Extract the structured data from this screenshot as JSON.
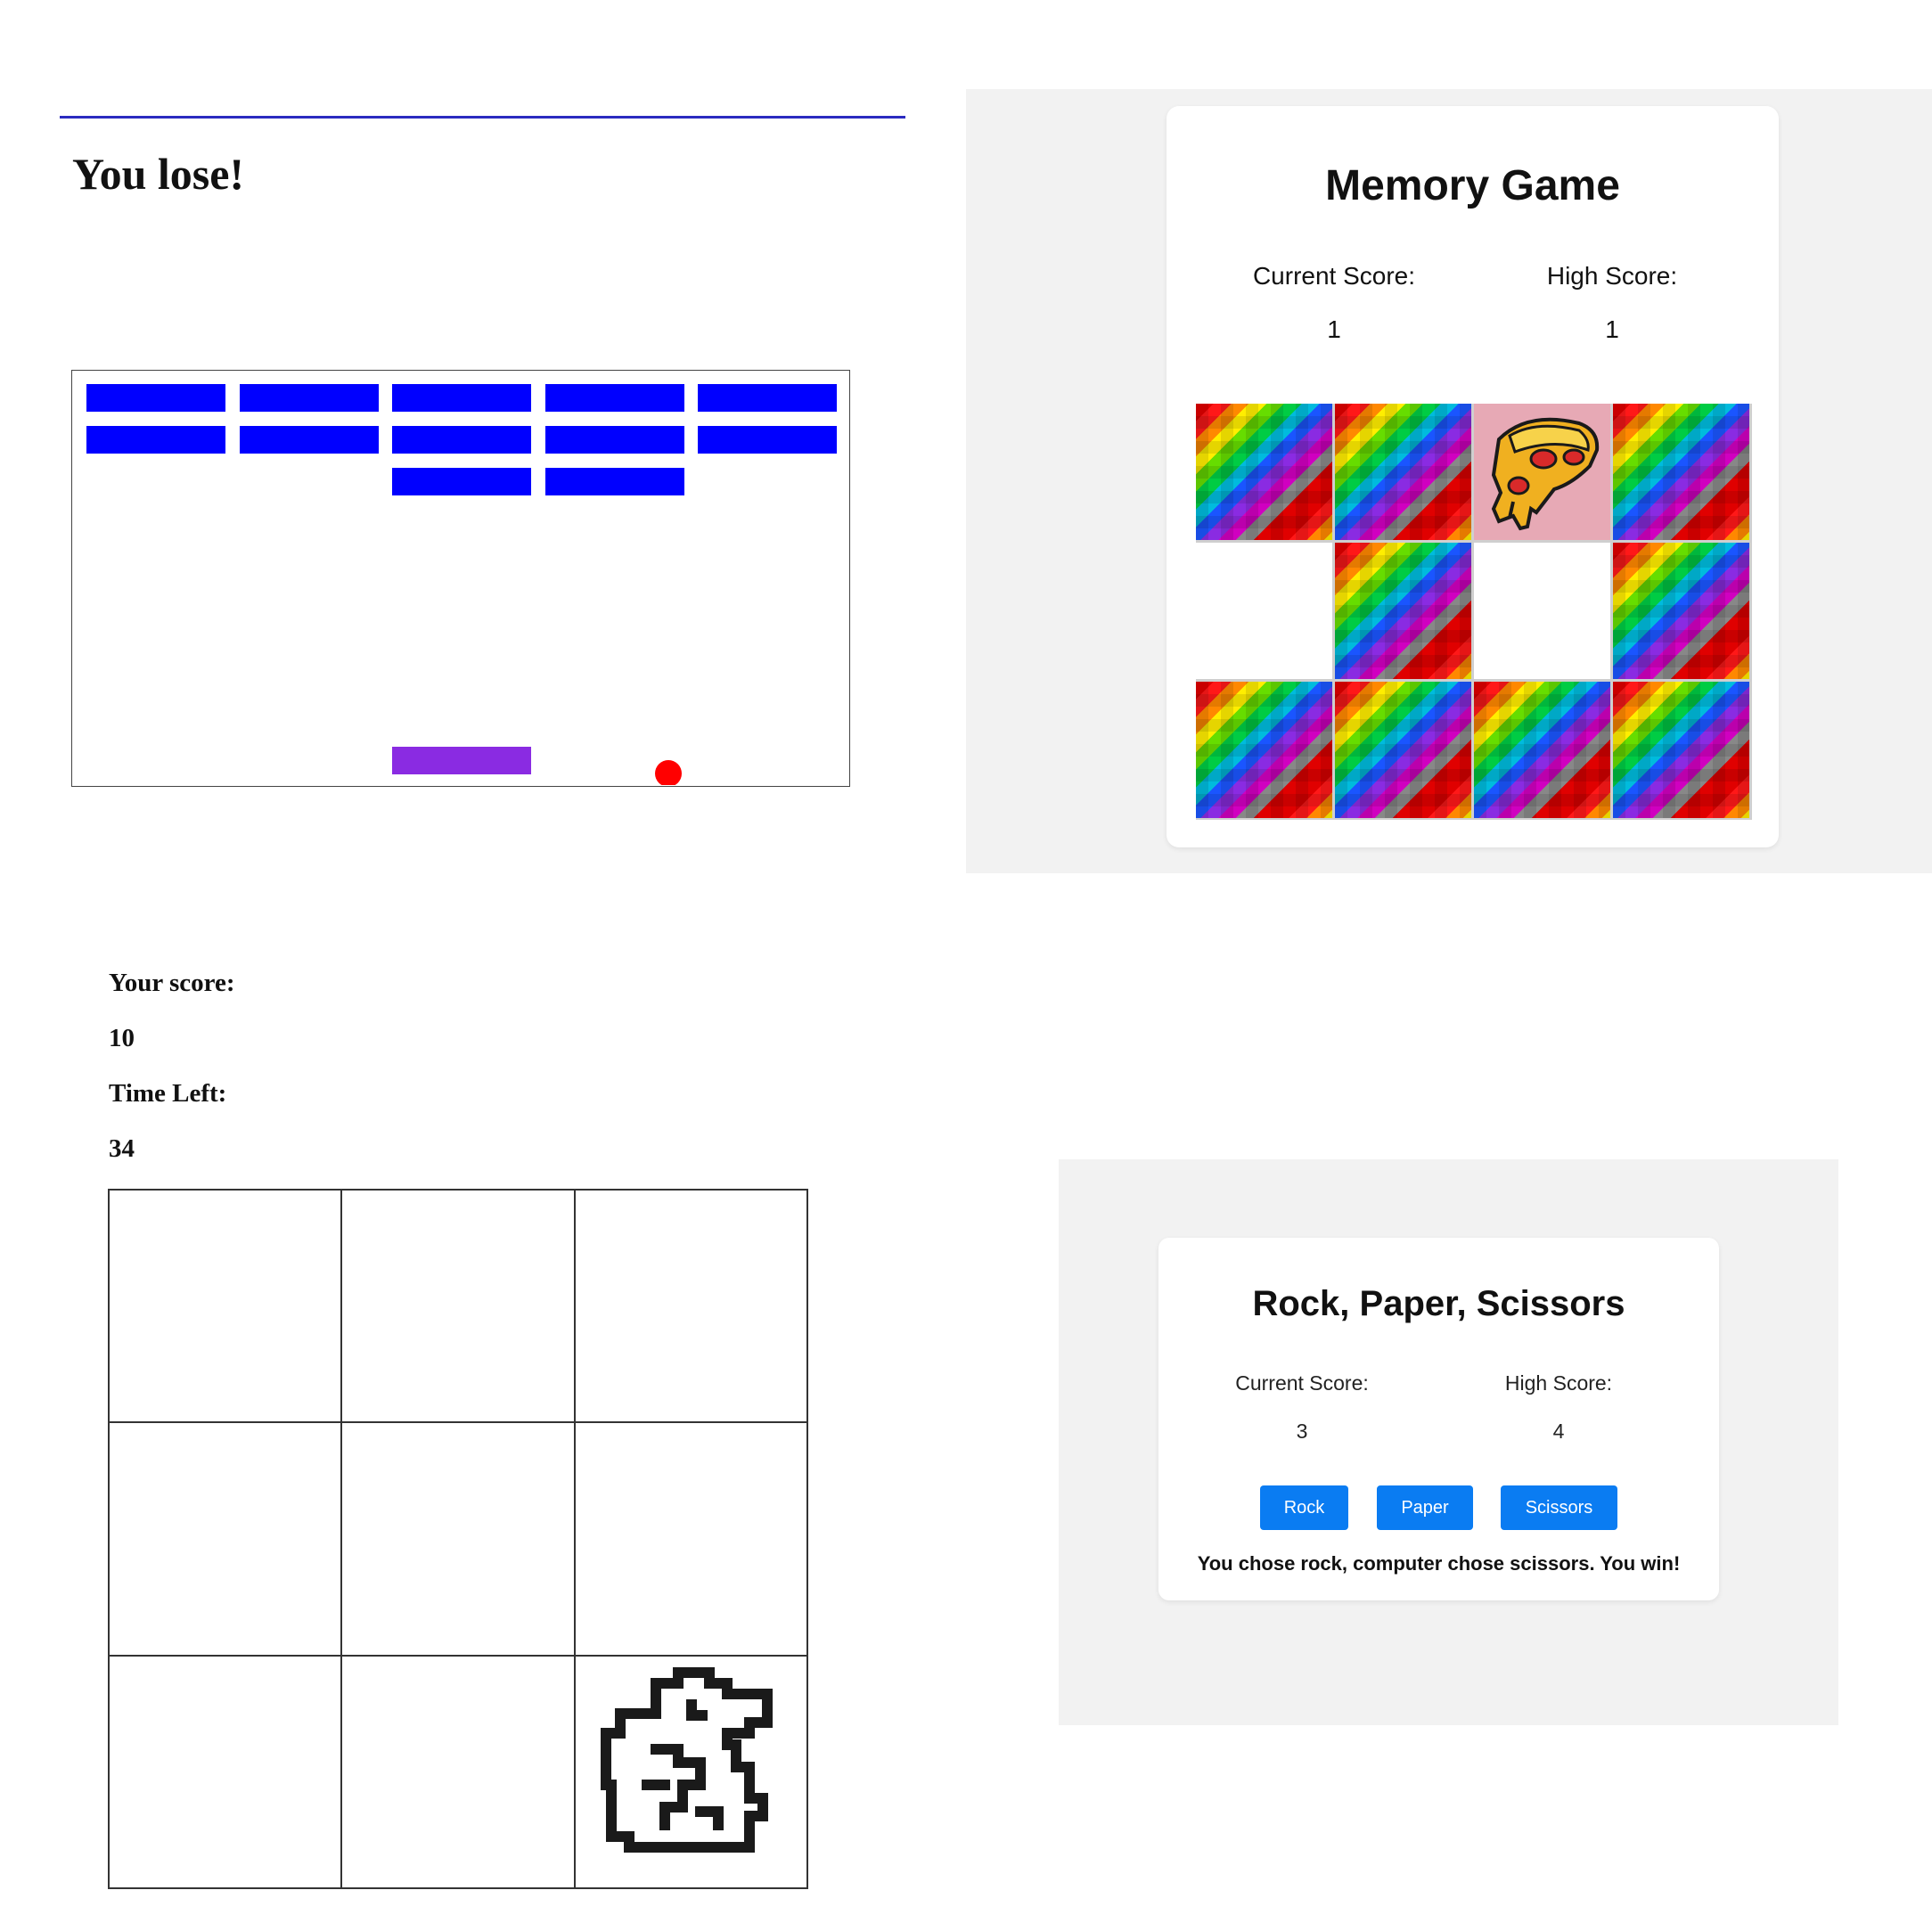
{
  "breakout": {
    "status": "You lose!",
    "colors": {
      "brick": "#0000ff",
      "paddle": "#8a2be2",
      "ball": "#ff0000",
      "rule": "#2b2bc0"
    },
    "brick_rows": [
      [
        true,
        true,
        true,
        true,
        true
      ],
      [
        true,
        true,
        true,
        true,
        true
      ],
      [
        false,
        false,
        true,
        true,
        false
      ]
    ]
  },
  "memory": {
    "title": "Memory Game",
    "current_score_label": "Current Score:",
    "current_score": "1",
    "high_score_label": "High Score:",
    "high_score": "1",
    "tiles": [
      "back",
      "back",
      "pizza",
      "back",
      "empty",
      "back",
      "empty",
      "back",
      "back",
      "back",
      "back",
      "back"
    ]
  },
  "whack": {
    "score_label": "Your score:",
    "score": "10",
    "time_label": "Time Left:",
    "time": "34",
    "mole_cell": 8
  },
  "rps": {
    "title": "Rock, Paper, Scissors",
    "current_score_label": "Current Score:",
    "current_score": "3",
    "high_score_label": "High Score:",
    "high_score": "4",
    "buttons": {
      "rock": "Rock",
      "paper": "Paper",
      "scissors": "Scissors"
    },
    "result": "You chose rock, computer chose scissors. You win!",
    "button_color": "#0a7cf2"
  }
}
